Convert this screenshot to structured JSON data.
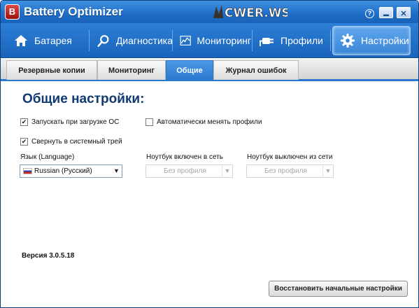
{
  "app": {
    "title": "Battery Optimizer",
    "logo_letter": "B",
    "watermark": "CWER.WS"
  },
  "window_controls": {
    "help": "?",
    "minimize": "▬",
    "close": "✕"
  },
  "main_nav": [
    {
      "label": "Батарея",
      "icon": "home-icon"
    },
    {
      "label": "Диагностика",
      "icon": "magnifier-icon"
    },
    {
      "label": "Мониторинг",
      "icon": "chart-icon"
    },
    {
      "label": "Профили",
      "icon": "plug-icon"
    },
    {
      "label": "Настройки",
      "icon": "gear-icon",
      "active": true
    }
  ],
  "sub_tabs": [
    {
      "label": "Резервные копии"
    },
    {
      "label": "Мониторинг"
    },
    {
      "label": "Общие",
      "active": true
    },
    {
      "label": "Журнал ошибок"
    }
  ],
  "content": {
    "heading": "Общие настройки:",
    "checkboxes": {
      "startup": {
        "label": "Запускать при загрузке ОС",
        "checked": true
      },
      "auto_profiles": {
        "label": "Автоматически менять профили",
        "checked": false
      },
      "minimize_tray": {
        "label": "Свернуть в системный трей",
        "checked": true
      }
    },
    "language": {
      "label": "Язык (Language)",
      "value": "Russian (Русский)"
    },
    "plugged": {
      "label": "Ноутбук включен в сеть",
      "value": "Без профиля"
    },
    "unplugged": {
      "label": "Ноутбук выключен из сети",
      "value": "Без профиля"
    },
    "version": "Версия 3.0.5.18",
    "restore_button": "Восстановить начальные настройки"
  },
  "colors": {
    "accent": "#2a78cf",
    "title_bar": "#1f6dc7",
    "heading": "#0f3a73"
  }
}
